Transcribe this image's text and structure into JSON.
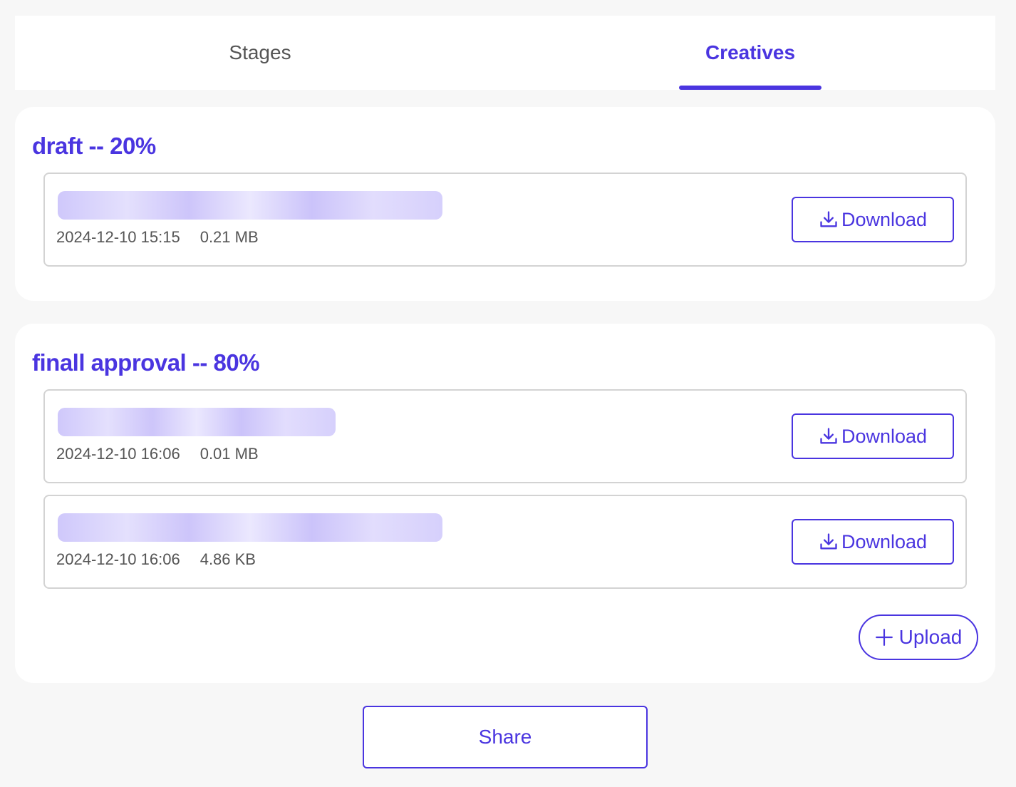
{
  "tabs": [
    {
      "label": "Stages",
      "active": false
    },
    {
      "label": "Creatives",
      "active": true
    }
  ],
  "stages": [
    {
      "title": "draft -- 20%",
      "files": [
        {
          "name": "",
          "date": "2024-12-10 15:15",
          "size": "0.21 MB",
          "download_label": "Download"
        }
      ]
    },
    {
      "title": "finall approval -- 80%",
      "files": [
        {
          "name": "",
          "date": "2024-12-10 16:06",
          "size": "0.01 MB",
          "download_label": "Download"
        },
        {
          "name": "",
          "date": "2024-12-10 16:06",
          "size": "4.86 KB",
          "download_label": "Download"
        }
      ],
      "upload_label": "Upload"
    }
  ],
  "share_label": "Share",
  "colors": {
    "accent": "#4a35e0",
    "muted_text": "#555555",
    "border": "#d3d3d3",
    "background": "#f7f7f7"
  },
  "icons": {
    "download": "download-icon",
    "upload": "plus-icon"
  }
}
